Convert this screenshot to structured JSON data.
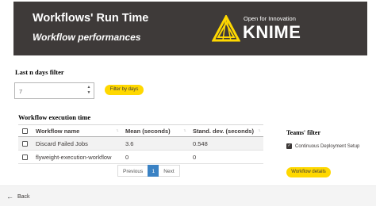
{
  "header": {
    "title": "Workflows' Run Time",
    "subtitle": "Workflow performances",
    "logo_tagline": "Open for Innovation",
    "logo_word": "KNIME"
  },
  "filter": {
    "label": "Last n days filter",
    "input_value": "7",
    "button_label": "Filter by days"
  },
  "execution": {
    "label": "Workflow execution time",
    "columns": [
      "Workflow name",
      "Mean (seconds)",
      "Stand. dev. (seconds)"
    ],
    "rows": [
      {
        "name": "Discard Failed Jobs",
        "mean": "3.6",
        "std": "0.548"
      },
      {
        "name": "flyweight-execution-workflow",
        "mean": "0",
        "std": "0"
      }
    ],
    "pagination": {
      "previous": "Previous",
      "current": "1",
      "next": "Next"
    }
  },
  "teams": {
    "label": "Teams' filter",
    "option": "Continuous Deployment Setup",
    "option_checked": true,
    "button_label": "Workflow details"
  },
  "footer": {
    "back_label": "Back"
  },
  "colors": {
    "header_bg": "#3e3a39",
    "accent": "#ffd800",
    "pager_active": "#3a82c4"
  }
}
